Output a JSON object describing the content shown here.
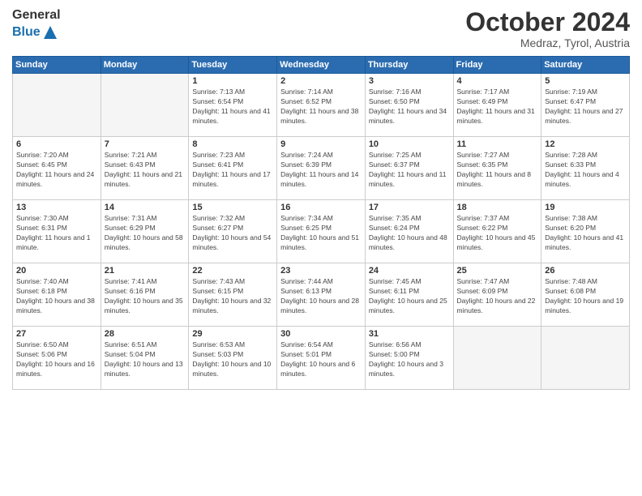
{
  "logo": {
    "general": "General",
    "blue": "Blue"
  },
  "title": "October 2024",
  "location": "Medraz, Tyrol, Austria",
  "weekdays": [
    "Sunday",
    "Monday",
    "Tuesday",
    "Wednesday",
    "Thursday",
    "Friday",
    "Saturday"
  ],
  "days": [
    {
      "num": "",
      "info": ""
    },
    {
      "num": "",
      "info": ""
    },
    {
      "num": "1",
      "info": "Sunrise: 7:13 AM\nSunset: 6:54 PM\nDaylight: 11 hours and 41 minutes."
    },
    {
      "num": "2",
      "info": "Sunrise: 7:14 AM\nSunset: 6:52 PM\nDaylight: 11 hours and 38 minutes."
    },
    {
      "num": "3",
      "info": "Sunrise: 7:16 AM\nSunset: 6:50 PM\nDaylight: 11 hours and 34 minutes."
    },
    {
      "num": "4",
      "info": "Sunrise: 7:17 AM\nSunset: 6:49 PM\nDaylight: 11 hours and 31 minutes."
    },
    {
      "num": "5",
      "info": "Sunrise: 7:19 AM\nSunset: 6:47 PM\nDaylight: 11 hours and 27 minutes."
    },
    {
      "num": "6",
      "info": "Sunrise: 7:20 AM\nSunset: 6:45 PM\nDaylight: 11 hours and 24 minutes."
    },
    {
      "num": "7",
      "info": "Sunrise: 7:21 AM\nSunset: 6:43 PM\nDaylight: 11 hours and 21 minutes."
    },
    {
      "num": "8",
      "info": "Sunrise: 7:23 AM\nSunset: 6:41 PM\nDaylight: 11 hours and 17 minutes."
    },
    {
      "num": "9",
      "info": "Sunrise: 7:24 AM\nSunset: 6:39 PM\nDaylight: 11 hours and 14 minutes."
    },
    {
      "num": "10",
      "info": "Sunrise: 7:25 AM\nSunset: 6:37 PM\nDaylight: 11 hours and 11 minutes."
    },
    {
      "num": "11",
      "info": "Sunrise: 7:27 AM\nSunset: 6:35 PM\nDaylight: 11 hours and 8 minutes."
    },
    {
      "num": "12",
      "info": "Sunrise: 7:28 AM\nSunset: 6:33 PM\nDaylight: 11 hours and 4 minutes."
    },
    {
      "num": "13",
      "info": "Sunrise: 7:30 AM\nSunset: 6:31 PM\nDaylight: 11 hours and 1 minute."
    },
    {
      "num": "14",
      "info": "Sunrise: 7:31 AM\nSunset: 6:29 PM\nDaylight: 10 hours and 58 minutes."
    },
    {
      "num": "15",
      "info": "Sunrise: 7:32 AM\nSunset: 6:27 PM\nDaylight: 10 hours and 54 minutes."
    },
    {
      "num": "16",
      "info": "Sunrise: 7:34 AM\nSunset: 6:25 PM\nDaylight: 10 hours and 51 minutes."
    },
    {
      "num": "17",
      "info": "Sunrise: 7:35 AM\nSunset: 6:24 PM\nDaylight: 10 hours and 48 minutes."
    },
    {
      "num": "18",
      "info": "Sunrise: 7:37 AM\nSunset: 6:22 PM\nDaylight: 10 hours and 45 minutes."
    },
    {
      "num": "19",
      "info": "Sunrise: 7:38 AM\nSunset: 6:20 PM\nDaylight: 10 hours and 41 minutes."
    },
    {
      "num": "20",
      "info": "Sunrise: 7:40 AM\nSunset: 6:18 PM\nDaylight: 10 hours and 38 minutes."
    },
    {
      "num": "21",
      "info": "Sunrise: 7:41 AM\nSunset: 6:16 PM\nDaylight: 10 hours and 35 minutes."
    },
    {
      "num": "22",
      "info": "Sunrise: 7:43 AM\nSunset: 6:15 PM\nDaylight: 10 hours and 32 minutes."
    },
    {
      "num": "23",
      "info": "Sunrise: 7:44 AM\nSunset: 6:13 PM\nDaylight: 10 hours and 28 minutes."
    },
    {
      "num": "24",
      "info": "Sunrise: 7:45 AM\nSunset: 6:11 PM\nDaylight: 10 hours and 25 minutes."
    },
    {
      "num": "25",
      "info": "Sunrise: 7:47 AM\nSunset: 6:09 PM\nDaylight: 10 hours and 22 minutes."
    },
    {
      "num": "26",
      "info": "Sunrise: 7:48 AM\nSunset: 6:08 PM\nDaylight: 10 hours and 19 minutes."
    },
    {
      "num": "27",
      "info": "Sunrise: 6:50 AM\nSunset: 5:06 PM\nDaylight: 10 hours and 16 minutes."
    },
    {
      "num": "28",
      "info": "Sunrise: 6:51 AM\nSunset: 5:04 PM\nDaylight: 10 hours and 13 minutes."
    },
    {
      "num": "29",
      "info": "Sunrise: 6:53 AM\nSunset: 5:03 PM\nDaylight: 10 hours and 10 minutes."
    },
    {
      "num": "30",
      "info": "Sunrise: 6:54 AM\nSunset: 5:01 PM\nDaylight: 10 hours and 6 minutes."
    },
    {
      "num": "31",
      "info": "Sunrise: 6:56 AM\nSunset: 5:00 PM\nDaylight: 10 hours and 3 minutes."
    },
    {
      "num": "",
      "info": ""
    },
    {
      "num": "",
      "info": ""
    }
  ]
}
